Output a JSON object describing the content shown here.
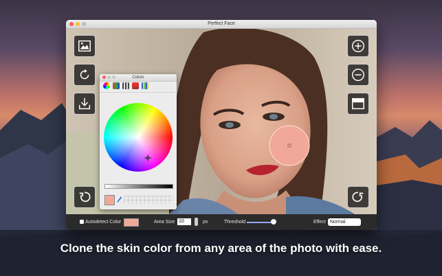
{
  "window": {
    "title": "Perfect Face"
  },
  "toolbar_left": {
    "open_image": "image-icon",
    "rotate": "rotate-icon",
    "save": "download-icon",
    "undo": "undo-icon"
  },
  "toolbar_right": {
    "zoom_in": "plus-circle-icon",
    "zoom_out": "minus-circle-icon",
    "split_view": "split-view-icon",
    "redo": "redo-icon"
  },
  "colors_panel": {
    "title": "Colors",
    "selected_color": "#f2a898"
  },
  "bottom_bar": {
    "autodetect_label": "Autodetect Color",
    "area_size_label": "Area Size",
    "area_size_value": "10",
    "px_label": "px",
    "threshold_label": "Threshold",
    "threshold_value": 0.9,
    "effect_label": "Effect",
    "effect_value": "Normal"
  },
  "caption": "Clone the skin color from any area of the photo with ease."
}
